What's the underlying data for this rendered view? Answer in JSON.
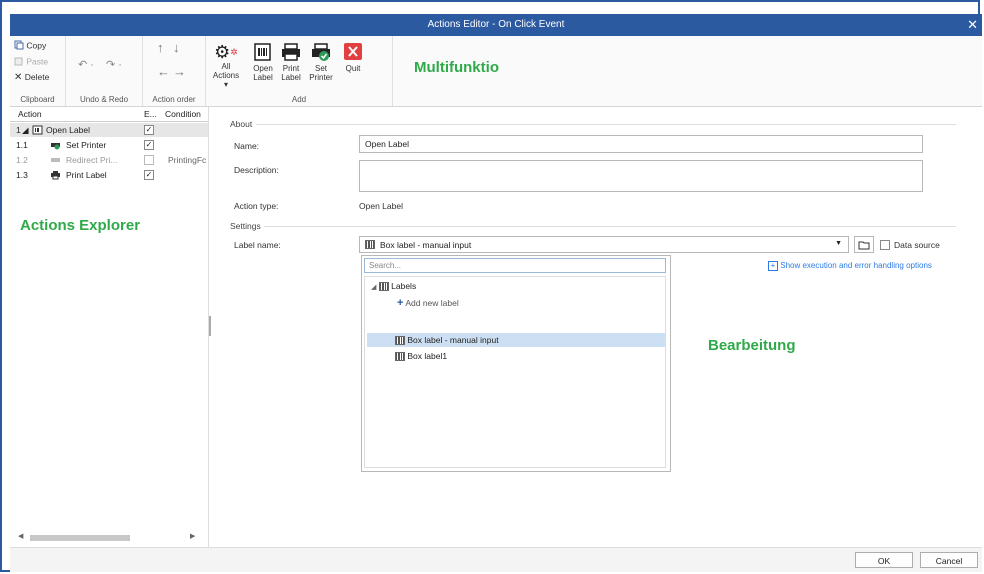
{
  "window": {
    "title": "Actions Editor - On Click Event",
    "close_glyph": "✕"
  },
  "ribbon": {
    "clipboard": {
      "copy": "Copy",
      "paste": "Paste",
      "delete": "Delete",
      "group_label": "Clipboard"
    },
    "undo_redo": {
      "group_label": "Undo & Redo"
    },
    "action_order": {
      "group_label": "Action order"
    },
    "add": {
      "all_actions": "All",
      "all_actions_line2": "Actions",
      "open_label_1": "Open",
      "open_label_2": "Label",
      "print_label_1": "Print",
      "print_label_2": "Label",
      "set_printer_1": "Set",
      "set_printer_2": "Printer",
      "quit": "Quit",
      "group_label": "Add"
    }
  },
  "callouts": {
    "ribbon": "Multifunktio",
    "explorer": "Actions Explorer",
    "editor": "Bearbeitung"
  },
  "explorer": {
    "headers": {
      "action": "Action",
      "enabled": "E...",
      "condition": "Condition"
    },
    "rows": [
      {
        "num": "1",
        "name": "Open Label",
        "checked": true,
        "condition": ""
      },
      {
        "num": "1.1",
        "name": "Set Printer",
        "checked": true,
        "condition": ""
      },
      {
        "num": "1.2",
        "name": "Redirect Pri...",
        "checked": false,
        "condition": "PrintingFc"
      },
      {
        "num": "1.3",
        "name": "Print Label",
        "checked": true,
        "condition": ""
      }
    ]
  },
  "editor": {
    "about_section": "About",
    "name_label": "Name:",
    "name_value": "Open Label",
    "description_label": "Description:",
    "description_value": "",
    "action_type_label": "Action type:",
    "action_type_value": "Open Label",
    "settings_section": "Settings",
    "label_name_label": "Label name:",
    "label_name_value": "Box label - manual input",
    "data_source": "Data source",
    "show_options_link": "Show execution and error handling options"
  },
  "dropdown_popup": {
    "search_placeholder": "Search...",
    "root": "Labels",
    "add_new": "Add new label",
    "items": [
      "Box label - manual input",
      "Box label1"
    ],
    "selected_index": 0
  },
  "footer": {
    "ok": "OK",
    "cancel": "Cancel"
  }
}
